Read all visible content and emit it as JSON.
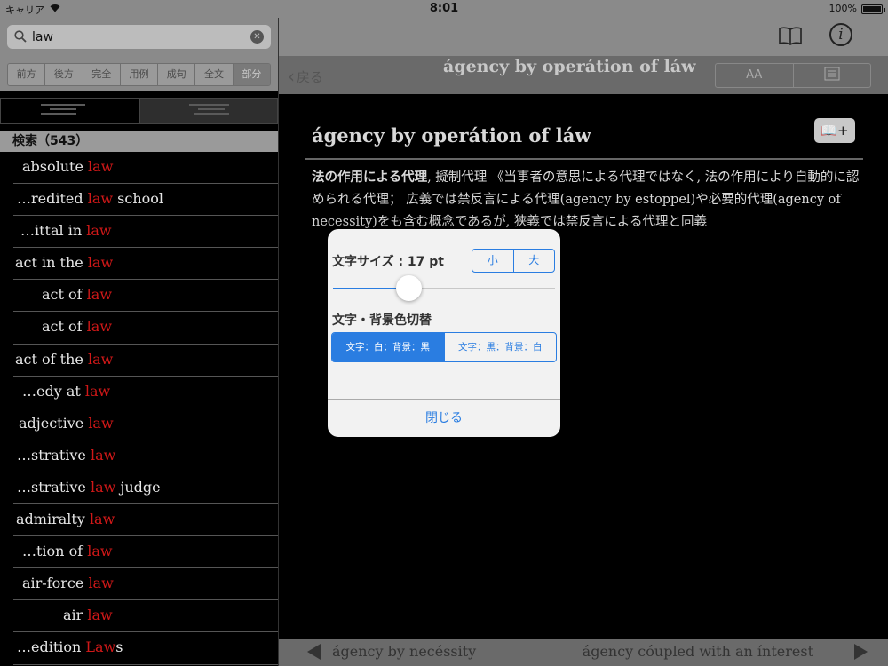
{
  "statusbar": {
    "carrier": "キャリア",
    "time": "8:01",
    "battery": "100%"
  },
  "search": {
    "value": "law"
  },
  "modes": [
    "前方",
    "後方",
    "完全",
    "用例",
    "成句",
    "全文",
    "部分"
  ],
  "list": {
    "header": "検索（543）",
    "rows": [
      {
        "pre": "absolute ",
        "hl": "law",
        "post": "",
        "indent": 10
      },
      {
        "pre": "…redited ",
        "hl": "law",
        "post": " school",
        "indent": 4
      },
      {
        "pre": "…ittal in ",
        "hl": "law",
        "post": "",
        "indent": 8
      },
      {
        "pre": "act in the ",
        "hl": "law",
        "post": "",
        "indent": 2
      },
      {
        "pre": "act of ",
        "hl": "law",
        "post": "",
        "indent": 32
      },
      {
        "pre": "act of ",
        "hl": "law",
        "post": "",
        "indent": 32
      },
      {
        "pre": "act of the ",
        "hl": "law",
        "post": "",
        "indent": 2
      },
      {
        "pre": "…edy at ",
        "hl": "law",
        "post": "",
        "indent": 10
      },
      {
        "pre": "adjective ",
        "hl": "law",
        "post": "",
        "indent": 6
      },
      {
        "pre": "…strative ",
        "hl": "law",
        "post": "",
        "indent": 4
      },
      {
        "pre": "…strative ",
        "hl": "law",
        "post": " judge",
        "indent": 4
      },
      {
        "pre": "admiralty ",
        "hl": "law",
        "post": "",
        "indent": 3
      },
      {
        "pre": "…tion of ",
        "hl": "law",
        "post": "",
        "indent": 10
      },
      {
        "pre": "air-force ",
        "hl": "law",
        "post": "",
        "indent": 10
      },
      {
        "pre": "air ",
        "hl": "law",
        "post": "",
        "indent": 56
      },
      {
        "pre": "…edition ",
        "hl": "Law",
        "post": "s",
        "indent": 4
      }
    ]
  },
  "nav": {
    "back": "戻る",
    "title": "ágency by operátion of láw",
    "tool_font": "AA"
  },
  "entry": {
    "title": "ágency by operátion of láw",
    "term": "法の作用による代理",
    "text": ", 擬制代理 《当事者の意思による代理ではなく, 法の作用により自動的に認められる代理； 広義では禁反言による代理(agency by estoppel)や必要的代理(agency of necessity)をも含む概念であるが, 狭義では禁反言による代理と同義",
    "addbook": "📖+"
  },
  "bottom": {
    "prev": "ágency by necéssity",
    "next": "ágency cóupled with an ínterest"
  },
  "popover": {
    "size_label": "文字サイズ : 17 pt",
    "size_small": "小",
    "size_large": "大",
    "size_level": 0.34,
    "color_label": "文字・背景色切替",
    "color_opt1": "文字：白：背景：黒",
    "color_opt2": "文字：黒：背景：白",
    "close": "閉じる"
  },
  "colors": {
    "accent": "#2a7de1",
    "highlight": "#d01818"
  }
}
